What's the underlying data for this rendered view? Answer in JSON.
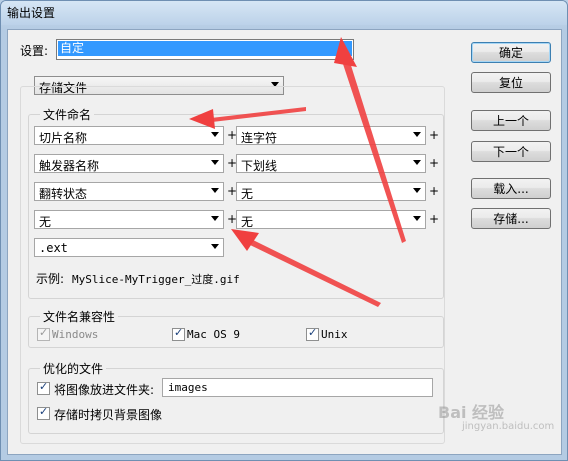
{
  "window": {
    "title": "输出设置"
  },
  "name_row": {
    "label": "设置:",
    "value": "自定"
  },
  "category_select": {
    "value": "存储文件"
  },
  "file_naming": {
    "title": "文件命名",
    "rows": [
      {
        "left": "切片名称",
        "right": "连字符"
      },
      {
        "left": "触发器名称",
        "right": "下划线"
      },
      {
        "left": "翻转状态",
        "right": "无"
      },
      {
        "left": "无",
        "right": "无"
      }
    ],
    "plus": "+",
    "extension": ".ext",
    "example_label": "示例:",
    "example_value": "MySlice-MyTrigger_过度.gif"
  },
  "compat": {
    "title": "文件名兼容性",
    "options": [
      {
        "label": "Windows",
        "checked": true,
        "disabled": true
      },
      {
        "label": "Mac OS 9",
        "checked": true,
        "disabled": false
      },
      {
        "label": "Unix",
        "checked": true,
        "disabled": false
      }
    ]
  },
  "optimized": {
    "title": "优化的文件",
    "put_images_label": "将图像放进文件夹:",
    "folder_value": "images",
    "copy_bg_label": "存储时拷贝背景图像"
  },
  "buttons": {
    "ok": "确定",
    "reset": "复位",
    "prev": "上一个",
    "next": "下一个",
    "load": "载入...",
    "save": "存储..."
  },
  "watermark": {
    "text": "Bai 经验",
    "sub": "jingyan.baidu.com"
  },
  "check_mark": "✓",
  "colors": {
    "accent": "#3399ff",
    "annotation": "#f04040"
  }
}
